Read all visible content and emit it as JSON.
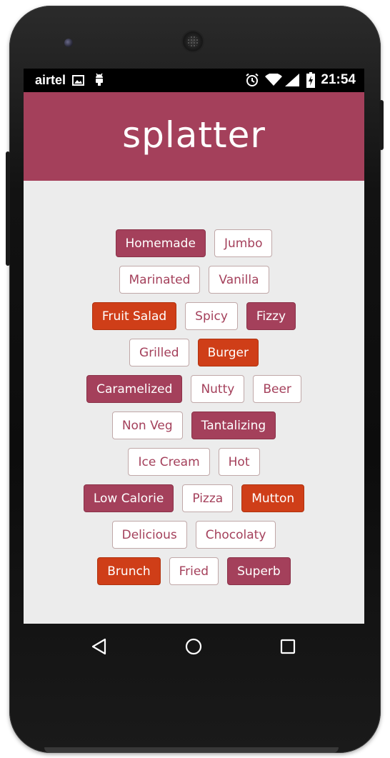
{
  "status_bar": {
    "carrier": "airtel",
    "time": "21:54",
    "icons": [
      "image-icon",
      "android-icon",
      "alarm-icon",
      "wifi-icon",
      "signal-icon",
      "battery-charging-icon"
    ]
  },
  "app_bar": {
    "title": "splatter"
  },
  "colors": {
    "primary": "#a4405b",
    "accent": "#cf3e18",
    "background": "#ececec",
    "outline_text": "#a4405b"
  },
  "tags": [
    [
      {
        "label": "Homemade",
        "style": "pink"
      },
      {
        "label": "Jumbo",
        "style": "outline"
      }
    ],
    [
      {
        "label": "Marinated",
        "style": "outline"
      },
      {
        "label": "Vanilla",
        "style": "outline"
      }
    ],
    [
      {
        "label": "Fruit Salad",
        "style": "orange"
      },
      {
        "label": "Spicy",
        "style": "outline"
      },
      {
        "label": "Fizzy",
        "style": "pink"
      }
    ],
    [
      {
        "label": "Grilled",
        "style": "outline"
      },
      {
        "label": "Burger",
        "style": "orange"
      }
    ],
    [
      {
        "label": "Caramelized",
        "style": "pink"
      },
      {
        "label": "Nutty",
        "style": "outline"
      },
      {
        "label": "Beer",
        "style": "outline"
      }
    ],
    [
      {
        "label": "Non Veg",
        "style": "outline"
      },
      {
        "label": "Tantalizing",
        "style": "pink"
      }
    ],
    [
      {
        "label": "Ice Cream",
        "style": "outline"
      },
      {
        "label": "Hot",
        "style": "outline"
      }
    ],
    [
      {
        "label": "Low Calorie",
        "style": "pink"
      },
      {
        "label": "Pizza",
        "style": "outline"
      },
      {
        "label": "Mutton",
        "style": "orange"
      }
    ],
    [
      {
        "label": "Delicious",
        "style": "outline"
      },
      {
        "label": "Chocolaty",
        "style": "outline"
      }
    ],
    [
      {
        "label": "Brunch",
        "style": "orange"
      },
      {
        "label": "Fried",
        "style": "outline"
      },
      {
        "label": "Superb",
        "style": "pink"
      }
    ]
  ],
  "nav_bar": {
    "buttons": [
      "back-icon",
      "home-icon",
      "recents-icon"
    ]
  }
}
